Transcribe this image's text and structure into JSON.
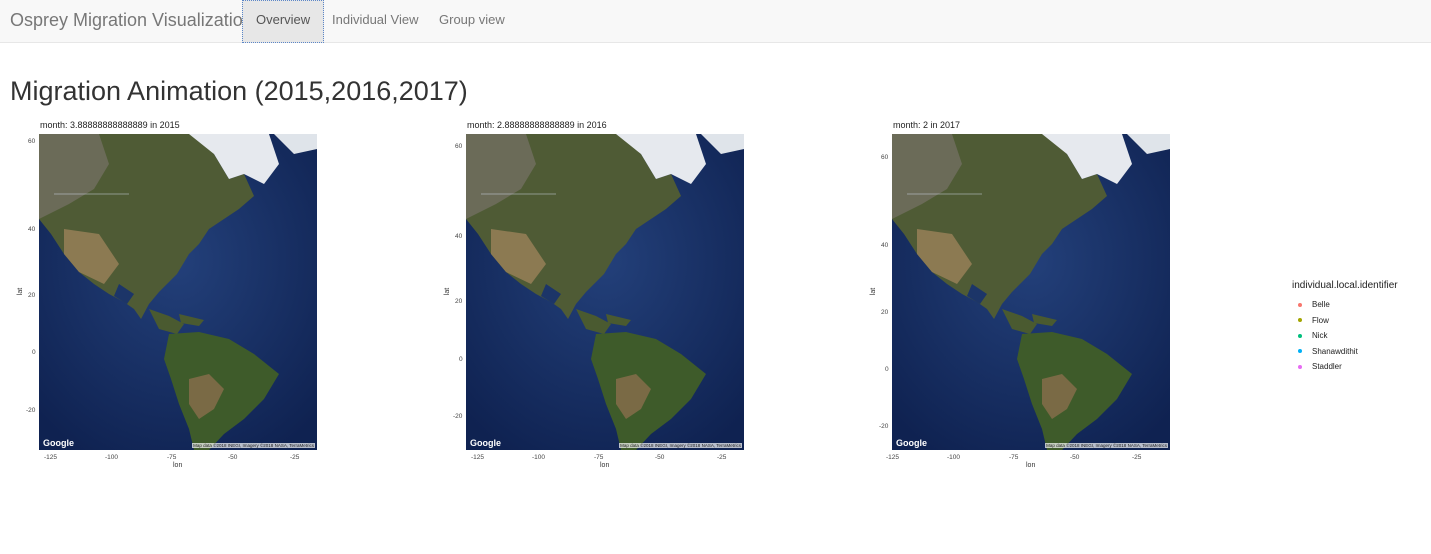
{
  "navbar": {
    "brand": "Osprey Migration Visualization",
    "tabs": [
      {
        "label": "Overview",
        "active": true
      },
      {
        "label": "Individual View",
        "active": false
      },
      {
        "label": "Group view",
        "active": false
      }
    ]
  },
  "page": {
    "title": "Migration Animation (2015,2016,2017)"
  },
  "map_credits": {
    "google": "Google",
    "attribution": "Map data ©2018 INEGI, Imagery ©2018 NASA, TerraMetrics"
  },
  "axes": {
    "xlabel": "lon",
    "ylabel": "lat",
    "xticks": [
      "-125",
      "-100",
      "-75",
      "-50",
      "-25"
    ]
  },
  "panels": [
    {
      "title": "month: 3.88888888888889 in 2015",
      "yticks": [
        "60",
        "40",
        "20",
        "0",
        "-20"
      ]
    },
    {
      "title": "month: 2.88888888888889 in 2016",
      "yticks": [
        "60",
        "40",
        "20",
        "0",
        "-20"
      ]
    },
    {
      "title": "month: 2 in 2017",
      "yticks": [
        "60",
        "40",
        "20",
        "0",
        "-20"
      ]
    }
  ],
  "legend": {
    "title": "individual.local.identifier",
    "items": [
      {
        "label": "Belle",
        "color": "#F8766D"
      },
      {
        "label": "Flow",
        "color": "#A3A500"
      },
      {
        "label": "Nick",
        "color": "#00BF7D"
      },
      {
        "label": "Shanawdithit",
        "color": "#00B0F6"
      },
      {
        "label": "Staddler",
        "color": "#E76BF3"
      }
    ]
  }
}
